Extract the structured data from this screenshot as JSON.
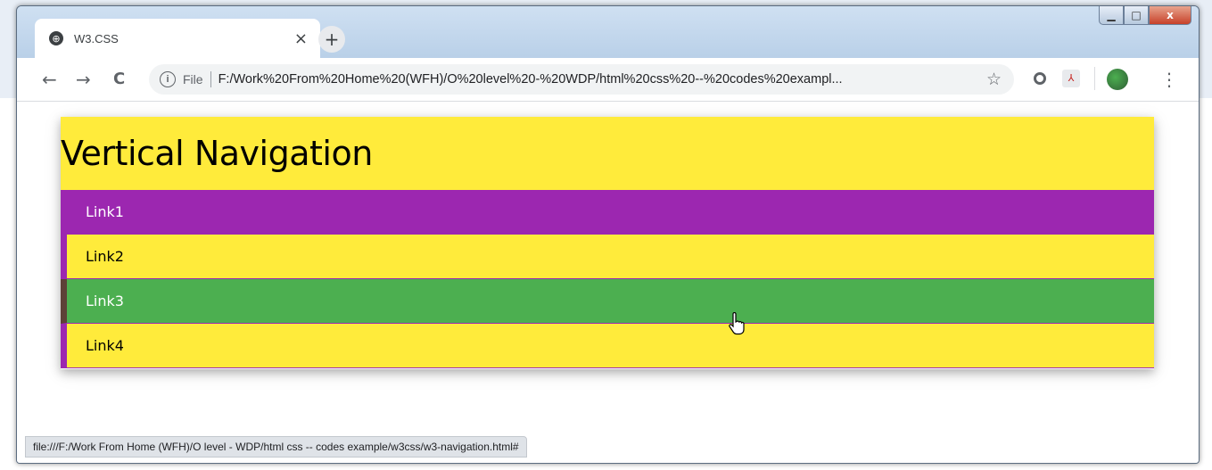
{
  "window": {
    "controls": {
      "minimize": "▁",
      "maximize": "□",
      "close": "x"
    }
  },
  "tab": {
    "title": "W3.CSS",
    "close": "×",
    "new_tab": "+"
  },
  "toolbar": {
    "back": "←",
    "forward": "→",
    "reload": "C",
    "info": "i",
    "file_label": "File",
    "url": "F:/Work%20From%20Home%20(WFH)/O%20level%20-%20WDP/html%20css%20--%20codes%20exampl...",
    "star": "☆",
    "menu": "⋮"
  },
  "content": {
    "heading": "Vertical Navigation",
    "links": [
      {
        "label": "Link1",
        "state": "active",
        "color": "#9c27b0"
      },
      {
        "label": "Link2",
        "state": "normal",
        "color": "#ffeb3b"
      },
      {
        "label": "Link3",
        "state": "hover",
        "color": "#4caf50"
      },
      {
        "label": "Link4",
        "state": "normal",
        "color": "#ffeb3b"
      }
    ]
  },
  "status": {
    "text": "file:///F:/Work From Home (WFH)/O level - WDP/html css -- codes example/w3css/w3-navigation.html#"
  },
  "colors": {
    "header": "#ffeb3b",
    "accent": "#9c27b0",
    "hover": "#4caf50"
  }
}
